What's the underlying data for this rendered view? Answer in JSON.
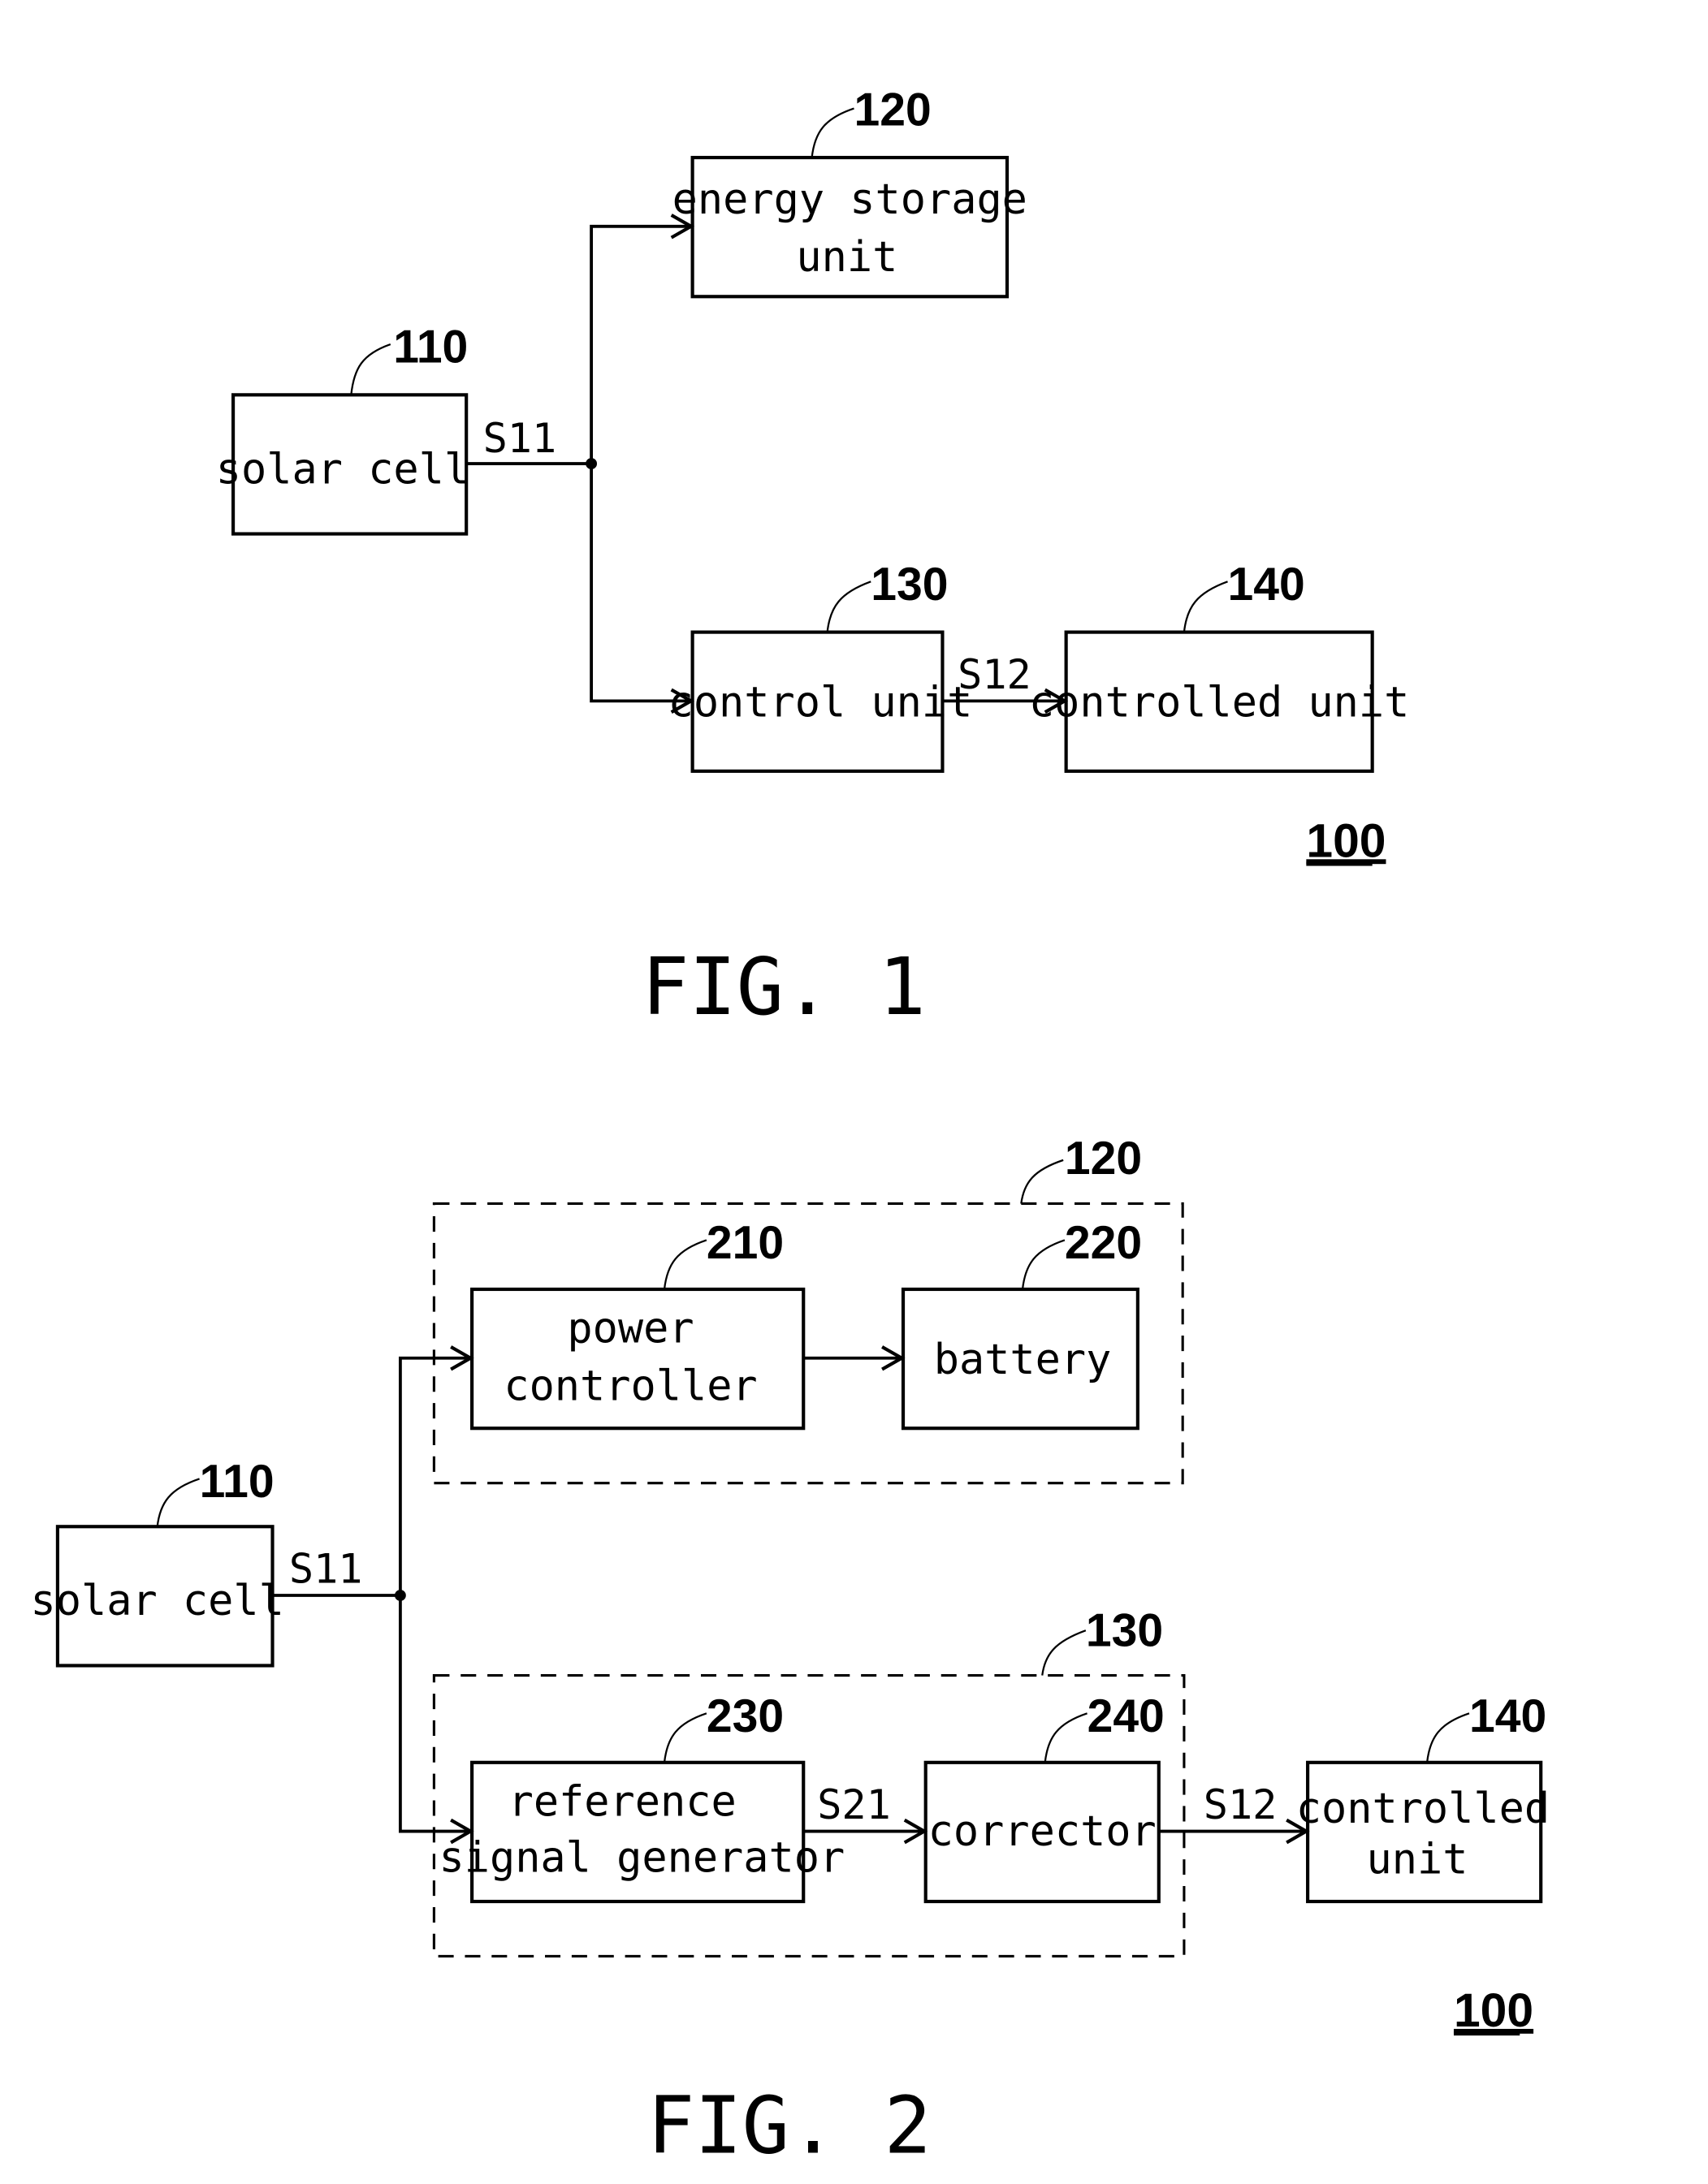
{
  "fig1": {
    "caption": "FIG. 1",
    "system_ref": "100",
    "blocks": {
      "solar_cell": {
        "ref": "110",
        "lines": [
          "solar cell"
        ]
      },
      "energy_storage": {
        "ref": "120",
        "lines": [
          "energy storage",
          "unit"
        ]
      },
      "control_unit": {
        "ref": "130",
        "lines": [
          "control unit"
        ]
      },
      "controlled_unit": {
        "ref": "140",
        "lines": [
          "controlled unit"
        ]
      }
    },
    "signals": {
      "s11": "S11",
      "s12": "S12"
    }
  },
  "fig2": {
    "caption": "FIG. 2",
    "system_ref": "100",
    "groups": {
      "energy_storage": {
        "ref": "120"
      },
      "control_unit": {
        "ref": "130"
      }
    },
    "blocks": {
      "solar_cell": {
        "ref": "110",
        "lines": [
          "solar cell"
        ]
      },
      "power_controller": {
        "ref": "210",
        "lines": [
          "power",
          "controller"
        ]
      },
      "battery": {
        "ref": "220",
        "lines": [
          "battery"
        ]
      },
      "ref_signal_gen": {
        "ref": "230",
        "lines": [
          "reference",
          "signal generator"
        ]
      },
      "corrector": {
        "ref": "240",
        "lines": [
          "corrector"
        ]
      },
      "controlled_unit": {
        "ref": "140",
        "lines": [
          "controlled",
          "unit"
        ]
      }
    },
    "signals": {
      "s11": "S11",
      "s21": "S21",
      "s12": "S12"
    }
  }
}
